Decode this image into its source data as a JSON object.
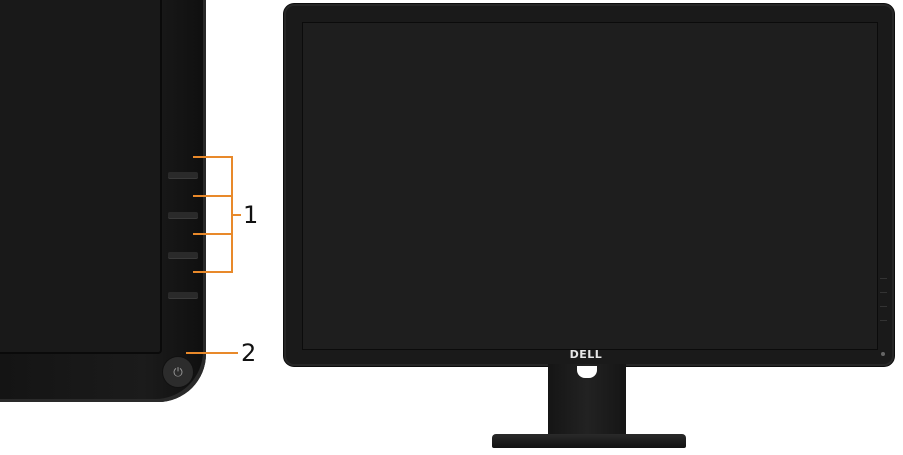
{
  "callouts": [
    {
      "number": "1",
      "target": "menu-buttons"
    },
    {
      "number": "2",
      "target": "power-button"
    }
  ],
  "brand": {
    "logo_text": "DELL"
  },
  "icons": {
    "power": "power-icon"
  },
  "colors": {
    "callout_line": "#e8892a",
    "bezel": "#1a1a1a",
    "screen": "#1e1e1e",
    "background": "#ffffff"
  }
}
